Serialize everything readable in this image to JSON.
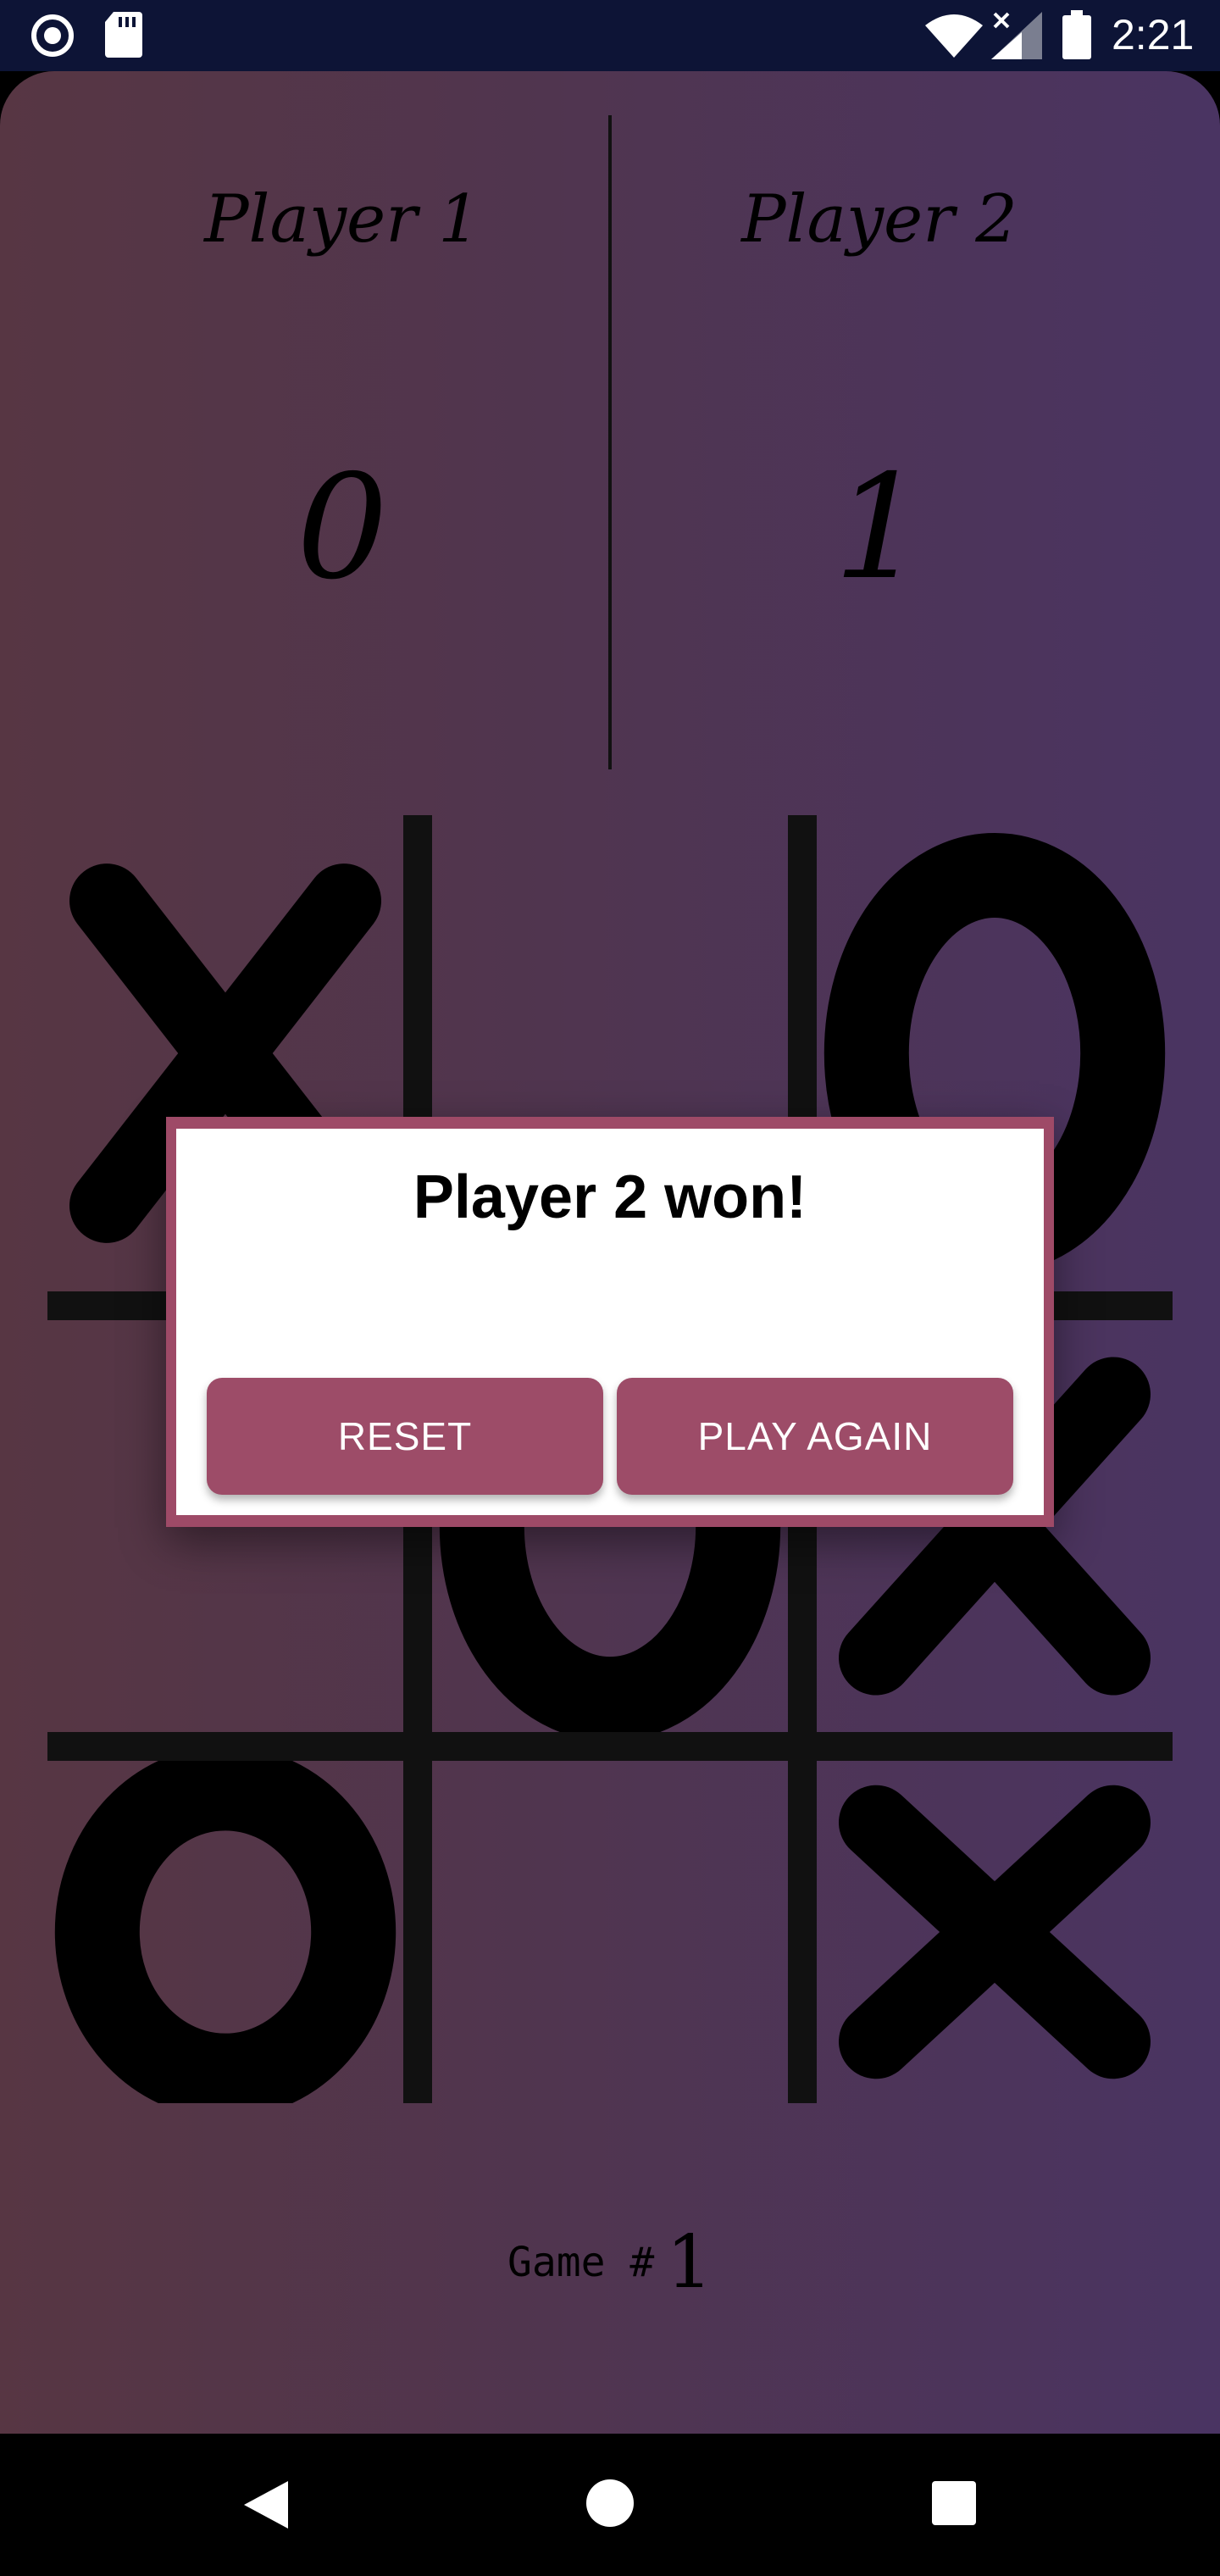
{
  "status_bar": {
    "time": "2:21",
    "icons": [
      "record-icon",
      "sd-card-icon",
      "wifi-icon",
      "no-signal-icon",
      "battery-icon"
    ]
  },
  "scoreboard": {
    "players": [
      {
        "name": "Player 1",
        "score": "0"
      },
      {
        "name": "Player 2",
        "score": "1"
      }
    ]
  },
  "board": {
    "cells": [
      "X",
      "",
      "O",
      "",
      "O",
      "X",
      "O",
      "",
      "X"
    ]
  },
  "game_counter": {
    "label": "Game #",
    "number": "1"
  },
  "dialog": {
    "title": "Player 2 won!",
    "reset_label": "RESET",
    "play_again_label": "PLAY AGAIN",
    "accent_color": "#9d4c68"
  },
  "nav_bar": {
    "icons": [
      "back-icon",
      "home-icon",
      "recents-icon"
    ]
  }
}
